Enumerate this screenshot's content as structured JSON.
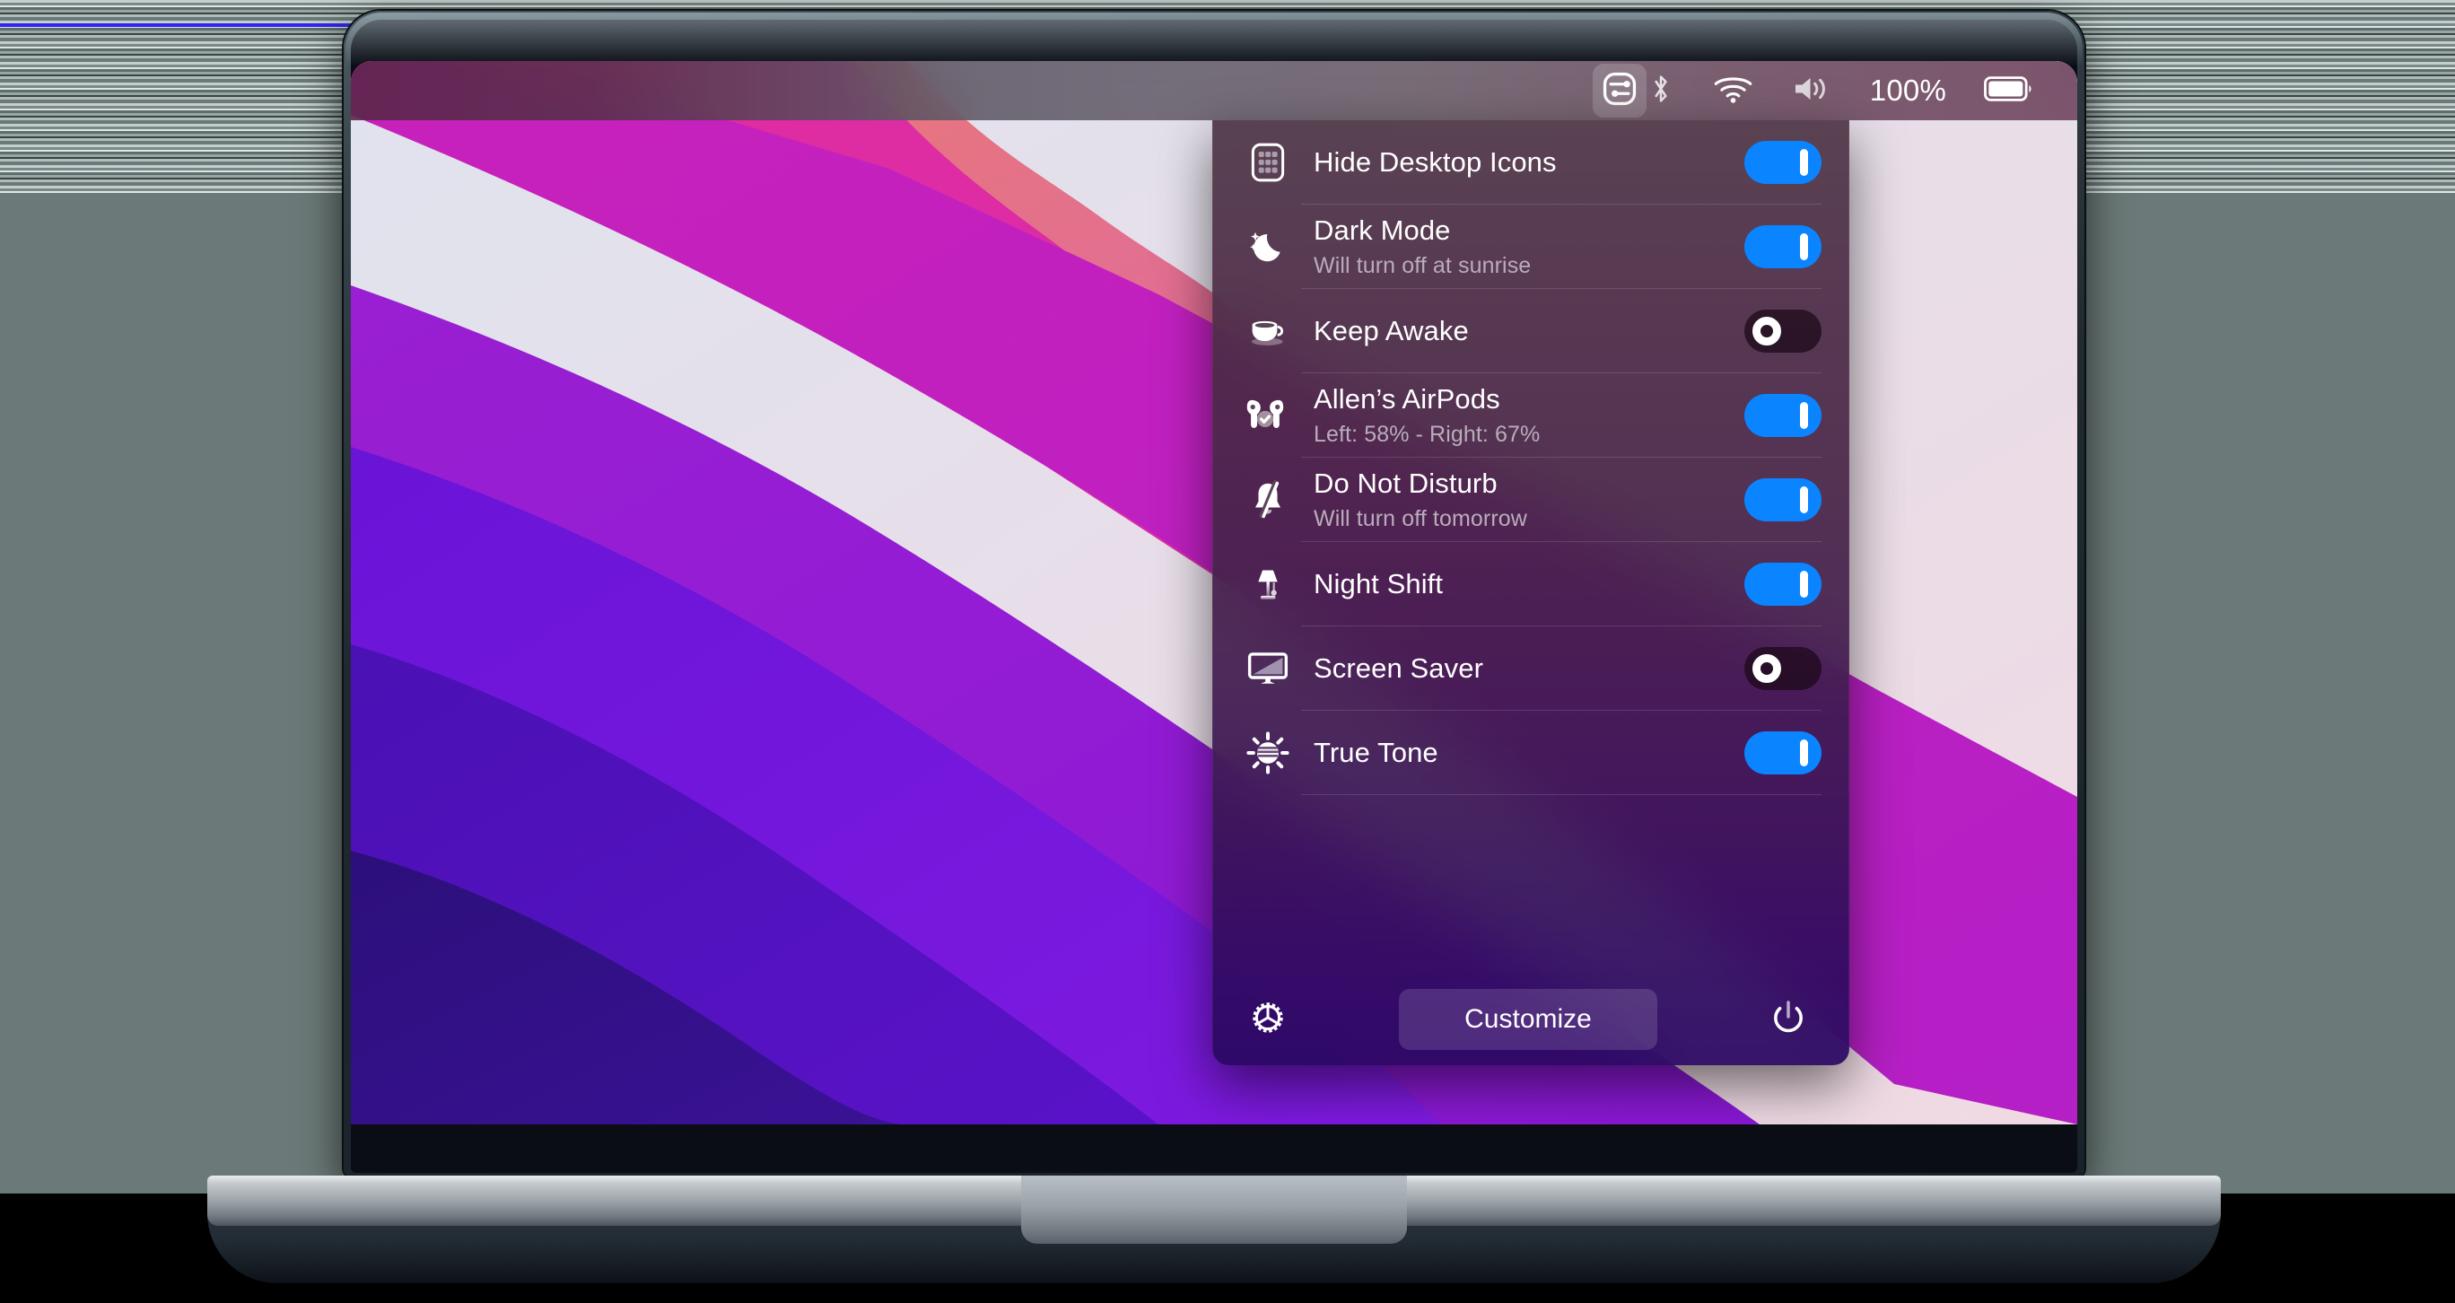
{
  "menubar": {
    "app_icon": "sliders-icon",
    "bluetooth_icon": "bluetooth-icon",
    "wifi_icon": "wifi-icon",
    "volume_icon": "volume-icon",
    "battery_percent": "100%",
    "battery_icon": "battery-full-icon"
  },
  "panel": {
    "accent_on_color": "#0a84ff",
    "rows": [
      {
        "icon": "desktop-grid-icon",
        "title": "Hide Desktop Icons",
        "subtitle": "",
        "state": "on"
      },
      {
        "icon": "moon-stars-icon",
        "title": "Dark Mode",
        "subtitle": "Will turn off at sunrise",
        "state": "on"
      },
      {
        "icon": "coffee-cup-icon",
        "title": "Keep Awake",
        "subtitle": "",
        "state": "off"
      },
      {
        "icon": "airpods-icon",
        "title": "Allen’s AirPods",
        "subtitle": "Left: 58% - Right: 67%",
        "state": "on"
      },
      {
        "icon": "bell-slash-icon",
        "title": "Do Not Disturb",
        "subtitle": "Will turn off tomorrow",
        "state": "on"
      },
      {
        "icon": "desk-lamp-icon",
        "title": "Night Shift",
        "subtitle": "",
        "state": "on"
      },
      {
        "icon": "display-icon",
        "title": "Screen Saver",
        "subtitle": "",
        "state": "off"
      },
      {
        "icon": "sun-stripes-icon",
        "title": "True Tone",
        "subtitle": "",
        "state": "on"
      }
    ],
    "footer": {
      "settings_icon": "gear-icon",
      "customize_label": "Customize",
      "power_icon": "power-icon"
    }
  }
}
